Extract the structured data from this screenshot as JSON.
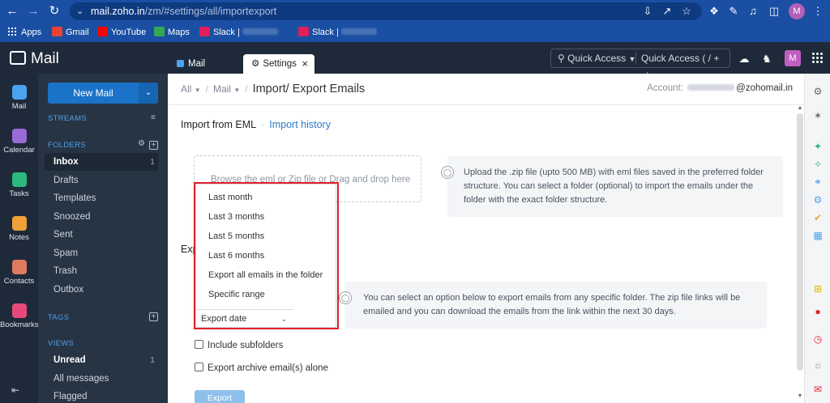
{
  "browser": {
    "url_host": "mail.zoho.in",
    "url_path": "/zm/#settings/all/importexport",
    "profile_initial": "M",
    "bookmarks": [
      {
        "label": "Apps"
      },
      {
        "label": "Gmail"
      },
      {
        "label": "YouTube"
      },
      {
        "label": "Maps"
      },
      {
        "label": "Slack |"
      },
      {
        "label": "Slack |"
      }
    ]
  },
  "app": {
    "name": "Mail",
    "tabs": [
      {
        "label": "Mail"
      },
      {
        "label": "Settings"
      }
    ],
    "quick_access": {
      "dropdown_label": "Quick Access",
      "shortcut_label": "Quick Access  ( / + q)"
    },
    "user_initial": "M"
  },
  "rail": {
    "items": [
      {
        "label": "Mail",
        "color": "#4ba3f0"
      },
      {
        "label": "Calendar",
        "color": "#9b6ad6"
      },
      {
        "label": "Tasks",
        "color": "#2db87d"
      },
      {
        "label": "Notes",
        "color": "#f0a13a"
      },
      {
        "label": "Contacts",
        "color": "#e07a5f"
      },
      {
        "label": "Bookmarks",
        "color": "#e8497a"
      }
    ]
  },
  "sidebar": {
    "new_mail_label": "New Mail",
    "streams_label": "STREAMS",
    "folders_label": "FOLDERS",
    "folders": [
      {
        "label": "Inbox",
        "count": "1"
      },
      {
        "label": "Drafts",
        "count": ""
      },
      {
        "label": "Templates",
        "count": ""
      },
      {
        "label": "Snoozed",
        "count": ""
      },
      {
        "label": "Sent",
        "count": ""
      },
      {
        "label": "Spam",
        "count": ""
      },
      {
        "label": "Trash",
        "count": ""
      },
      {
        "label": "Outbox",
        "count": ""
      }
    ],
    "tags_label": "TAGS",
    "views_label": "VIEWS",
    "views": [
      {
        "label": "Unread",
        "count": "1"
      },
      {
        "label": "All messages",
        "count": ""
      },
      {
        "label": "Flagged",
        "count": ""
      }
    ]
  },
  "main": {
    "breadcrumb": {
      "all": "All",
      "mail": "Mail",
      "title": "Import/ Export Emails"
    },
    "account_label": "Account:",
    "account_domain": "@zohomail.in",
    "import_title": "Import from EML",
    "import_history_link": "Import history",
    "dropzone_text": "Browse the eml or Zip file or Drag and drop here",
    "import_info": "Upload the .zip file (upto 500 MB) with eml files saved in the preferred folder structure. You can select a folder (optional) to import the emails under the folder with the exact folder structure.",
    "export_title_visible": "Exp",
    "export_info": "You can select an option below to export emails from any specific folder. The zip file links will be emailed and you can download the emails from the link within the next 30 days.",
    "export_date_options": [
      "Last month",
      "Last 3 months",
      "Last 5 months",
      "Last 6 months",
      "Export all emails in the folder",
      "Specific range"
    ],
    "export_date_selected": "Export date",
    "include_subfolders": "Include subfolders",
    "archive_only": "Export archive email(s) alone",
    "export_button": "Export"
  },
  "colors": {
    "browser_bar": "#1a4fa3",
    "app_bar": "#1e2a3a",
    "sidebar": "#273444",
    "accent": "#1a73c8",
    "highlight": "#e0222c"
  }
}
